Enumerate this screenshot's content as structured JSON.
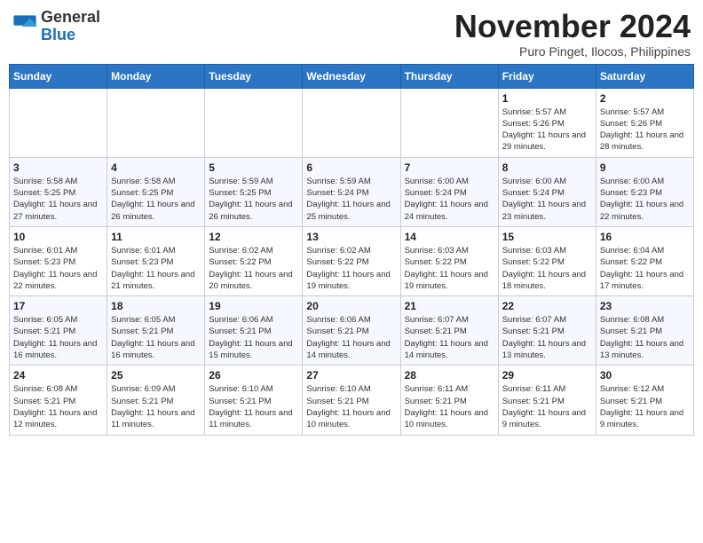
{
  "logo": {
    "line1": "General",
    "line2": "Blue"
  },
  "header": {
    "month": "November 2024",
    "location": "Puro Pinget, Ilocos, Philippines"
  },
  "weekdays": [
    "Sunday",
    "Monday",
    "Tuesday",
    "Wednesday",
    "Thursday",
    "Friday",
    "Saturday"
  ],
  "weeks": [
    [
      {
        "day": "",
        "detail": ""
      },
      {
        "day": "",
        "detail": ""
      },
      {
        "day": "",
        "detail": ""
      },
      {
        "day": "",
        "detail": ""
      },
      {
        "day": "",
        "detail": ""
      },
      {
        "day": "1",
        "detail": "Sunrise: 5:57 AM\nSunset: 5:26 PM\nDaylight: 11 hours and 29 minutes."
      },
      {
        "day": "2",
        "detail": "Sunrise: 5:57 AM\nSunset: 5:26 PM\nDaylight: 11 hours and 28 minutes."
      }
    ],
    [
      {
        "day": "3",
        "detail": "Sunrise: 5:58 AM\nSunset: 5:25 PM\nDaylight: 11 hours and 27 minutes."
      },
      {
        "day": "4",
        "detail": "Sunrise: 5:58 AM\nSunset: 5:25 PM\nDaylight: 11 hours and 26 minutes."
      },
      {
        "day": "5",
        "detail": "Sunrise: 5:59 AM\nSunset: 5:25 PM\nDaylight: 11 hours and 26 minutes."
      },
      {
        "day": "6",
        "detail": "Sunrise: 5:59 AM\nSunset: 5:24 PM\nDaylight: 11 hours and 25 minutes."
      },
      {
        "day": "7",
        "detail": "Sunrise: 6:00 AM\nSunset: 5:24 PM\nDaylight: 11 hours and 24 minutes."
      },
      {
        "day": "8",
        "detail": "Sunrise: 6:00 AM\nSunset: 5:24 PM\nDaylight: 11 hours and 23 minutes."
      },
      {
        "day": "9",
        "detail": "Sunrise: 6:00 AM\nSunset: 5:23 PM\nDaylight: 11 hours and 22 minutes."
      }
    ],
    [
      {
        "day": "10",
        "detail": "Sunrise: 6:01 AM\nSunset: 5:23 PM\nDaylight: 11 hours and 22 minutes."
      },
      {
        "day": "11",
        "detail": "Sunrise: 6:01 AM\nSunset: 5:23 PM\nDaylight: 11 hours and 21 minutes."
      },
      {
        "day": "12",
        "detail": "Sunrise: 6:02 AM\nSunset: 5:22 PM\nDaylight: 11 hours and 20 minutes."
      },
      {
        "day": "13",
        "detail": "Sunrise: 6:02 AM\nSunset: 5:22 PM\nDaylight: 11 hours and 19 minutes."
      },
      {
        "day": "14",
        "detail": "Sunrise: 6:03 AM\nSunset: 5:22 PM\nDaylight: 11 hours and 19 minutes."
      },
      {
        "day": "15",
        "detail": "Sunrise: 6:03 AM\nSunset: 5:22 PM\nDaylight: 11 hours and 18 minutes."
      },
      {
        "day": "16",
        "detail": "Sunrise: 6:04 AM\nSunset: 5:22 PM\nDaylight: 11 hours and 17 minutes."
      }
    ],
    [
      {
        "day": "17",
        "detail": "Sunrise: 6:05 AM\nSunset: 5:21 PM\nDaylight: 11 hours and 16 minutes."
      },
      {
        "day": "18",
        "detail": "Sunrise: 6:05 AM\nSunset: 5:21 PM\nDaylight: 11 hours and 16 minutes."
      },
      {
        "day": "19",
        "detail": "Sunrise: 6:06 AM\nSunset: 5:21 PM\nDaylight: 11 hours and 15 minutes."
      },
      {
        "day": "20",
        "detail": "Sunrise: 6:06 AM\nSunset: 5:21 PM\nDaylight: 11 hours and 14 minutes."
      },
      {
        "day": "21",
        "detail": "Sunrise: 6:07 AM\nSunset: 5:21 PM\nDaylight: 11 hours and 14 minutes."
      },
      {
        "day": "22",
        "detail": "Sunrise: 6:07 AM\nSunset: 5:21 PM\nDaylight: 11 hours and 13 minutes."
      },
      {
        "day": "23",
        "detail": "Sunrise: 6:08 AM\nSunset: 5:21 PM\nDaylight: 11 hours and 13 minutes."
      }
    ],
    [
      {
        "day": "24",
        "detail": "Sunrise: 6:08 AM\nSunset: 5:21 PM\nDaylight: 11 hours and 12 minutes."
      },
      {
        "day": "25",
        "detail": "Sunrise: 6:09 AM\nSunset: 5:21 PM\nDaylight: 11 hours and 11 minutes."
      },
      {
        "day": "26",
        "detail": "Sunrise: 6:10 AM\nSunset: 5:21 PM\nDaylight: 11 hours and 11 minutes."
      },
      {
        "day": "27",
        "detail": "Sunrise: 6:10 AM\nSunset: 5:21 PM\nDaylight: 11 hours and 10 minutes."
      },
      {
        "day": "28",
        "detail": "Sunrise: 6:11 AM\nSunset: 5:21 PM\nDaylight: 11 hours and 10 minutes."
      },
      {
        "day": "29",
        "detail": "Sunrise: 6:11 AM\nSunset: 5:21 PM\nDaylight: 11 hours and 9 minutes."
      },
      {
        "day": "30",
        "detail": "Sunrise: 6:12 AM\nSunset: 5:21 PM\nDaylight: 11 hours and 9 minutes."
      }
    ]
  ]
}
